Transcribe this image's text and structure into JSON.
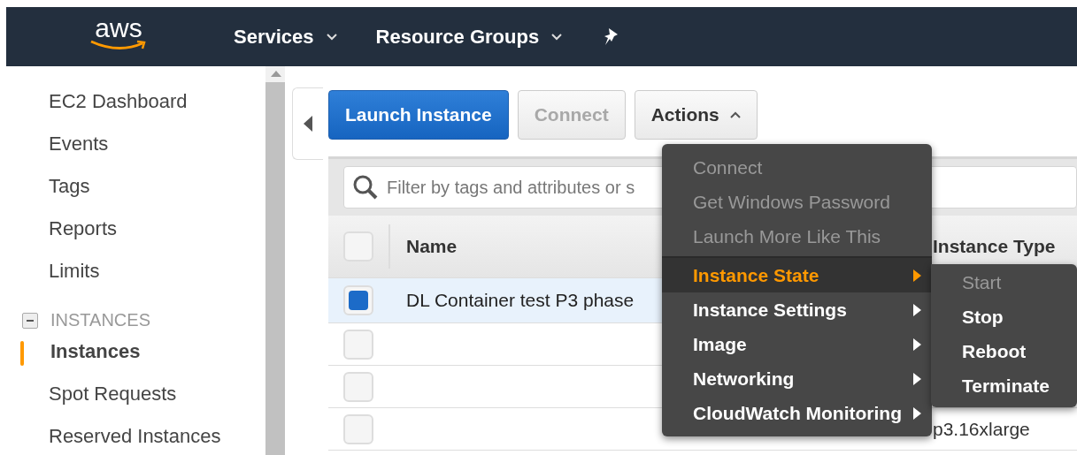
{
  "topbar": {
    "logo": "aws",
    "nav": [
      {
        "label": "Services"
      },
      {
        "label": "Resource Groups"
      }
    ]
  },
  "sidebar": {
    "items": [
      {
        "label": "EC2 Dashboard",
        "selected": false
      },
      {
        "label": "Events",
        "selected": false
      },
      {
        "label": "Tags",
        "selected": false
      },
      {
        "label": "Reports",
        "selected": false
      },
      {
        "label": "Limits",
        "selected": false
      }
    ],
    "section": {
      "title": "INSTANCES",
      "expanded": true,
      "items": [
        {
          "label": "Instances",
          "selected": true
        },
        {
          "label": "Spot Requests",
          "selected": false
        },
        {
          "label": "Reserved Instances",
          "selected": false
        }
      ]
    }
  },
  "toolbar": {
    "buttons": [
      {
        "label": "Launch Instance",
        "kind": "primary",
        "disabled": false
      },
      {
        "label": "Connect",
        "kind": "default",
        "disabled": true
      },
      {
        "label": "Actions",
        "kind": "dropdown",
        "disabled": false,
        "expanded": true
      }
    ]
  },
  "filter": {
    "placeholder": "Filter by tags and attributes or s"
  },
  "table": {
    "columns": [
      "Name",
      "Instance Type"
    ],
    "all_selected": false,
    "rows": [
      {
        "selected": true,
        "name": "DL Container test P3 phase",
        "instance_type": ""
      },
      {
        "selected": false,
        "name": "",
        "instance_type": ""
      },
      {
        "selected": false,
        "name": "",
        "instance_type": ""
      },
      {
        "selected": false,
        "name": "",
        "instance_type": "p3.16xlarge"
      }
    ]
  },
  "actions_menu": {
    "items": [
      {
        "label": "Connect",
        "kind": "action",
        "disabled": true,
        "selected": false
      },
      {
        "label": "Get Windows Password",
        "kind": "action",
        "disabled": true,
        "selected": false
      },
      {
        "label": "Launch More Like This",
        "kind": "action",
        "disabled": true,
        "selected": false
      },
      {
        "label": "Instance State",
        "kind": "submenu",
        "disabled": false,
        "selected": true
      },
      {
        "label": "Instance Settings",
        "kind": "submenu",
        "disabled": false,
        "selected": false
      },
      {
        "label": "Image",
        "kind": "submenu",
        "disabled": false,
        "selected": false
      },
      {
        "label": "Networking",
        "kind": "submenu",
        "disabled": false,
        "selected": false
      },
      {
        "label": "CloudWatch Monitoring",
        "kind": "submenu",
        "disabled": false,
        "selected": false
      }
    ]
  },
  "submenu": {
    "items": [
      {
        "label": "Start",
        "disabled": true
      },
      {
        "label": "Stop",
        "disabled": false
      },
      {
        "label": "Reboot",
        "disabled": false
      },
      {
        "label": "Terminate",
        "disabled": false
      }
    ]
  }
}
